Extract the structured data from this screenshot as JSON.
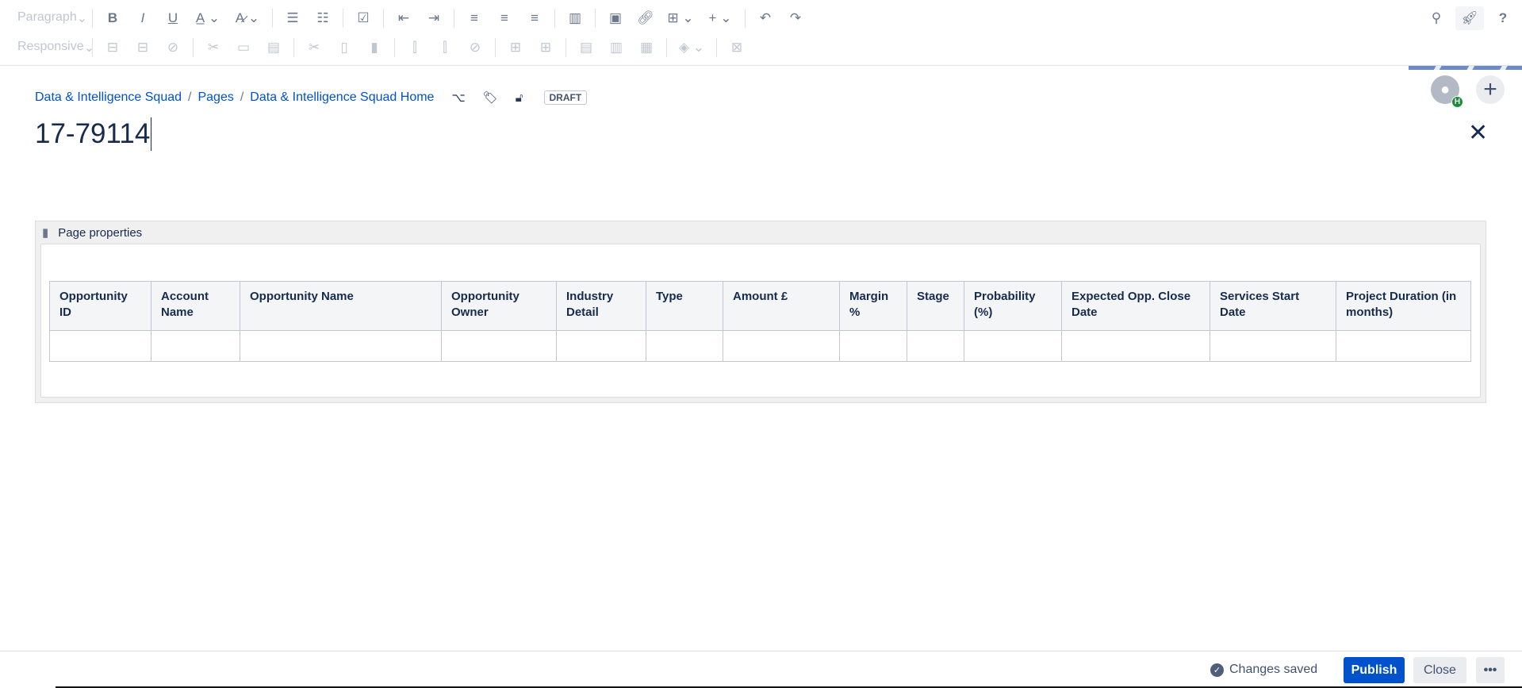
{
  "toolbar": {
    "paragraph": "Paragraph",
    "responsive": "Responsive"
  },
  "breadcrumb": [
    "Data & Intelligence Squad",
    "Pages",
    "Data & Intelligence Squad Home"
  ],
  "status_badge": "DRAFT",
  "page_title": "17-79114",
  "avatar_badge": "H",
  "macro": {
    "title": "Page properties",
    "columns": [
      "Opportunity ID",
      "Account Name",
      "Opportunity Name",
      "Opportunity Owner",
      "Industry Detail",
      "Type",
      "Amount £",
      "Margin %",
      "Stage",
      "Probability (%)",
      "Expected Opp. Close Date",
      "Services Start Date",
      "Project Duration (in months)"
    ]
  },
  "footer": {
    "status": "Changes saved",
    "publish": "Publish",
    "close": "Close",
    "more": "•••"
  },
  "colors": {
    "accent": "#0052cc",
    "link": "#0052cc"
  }
}
